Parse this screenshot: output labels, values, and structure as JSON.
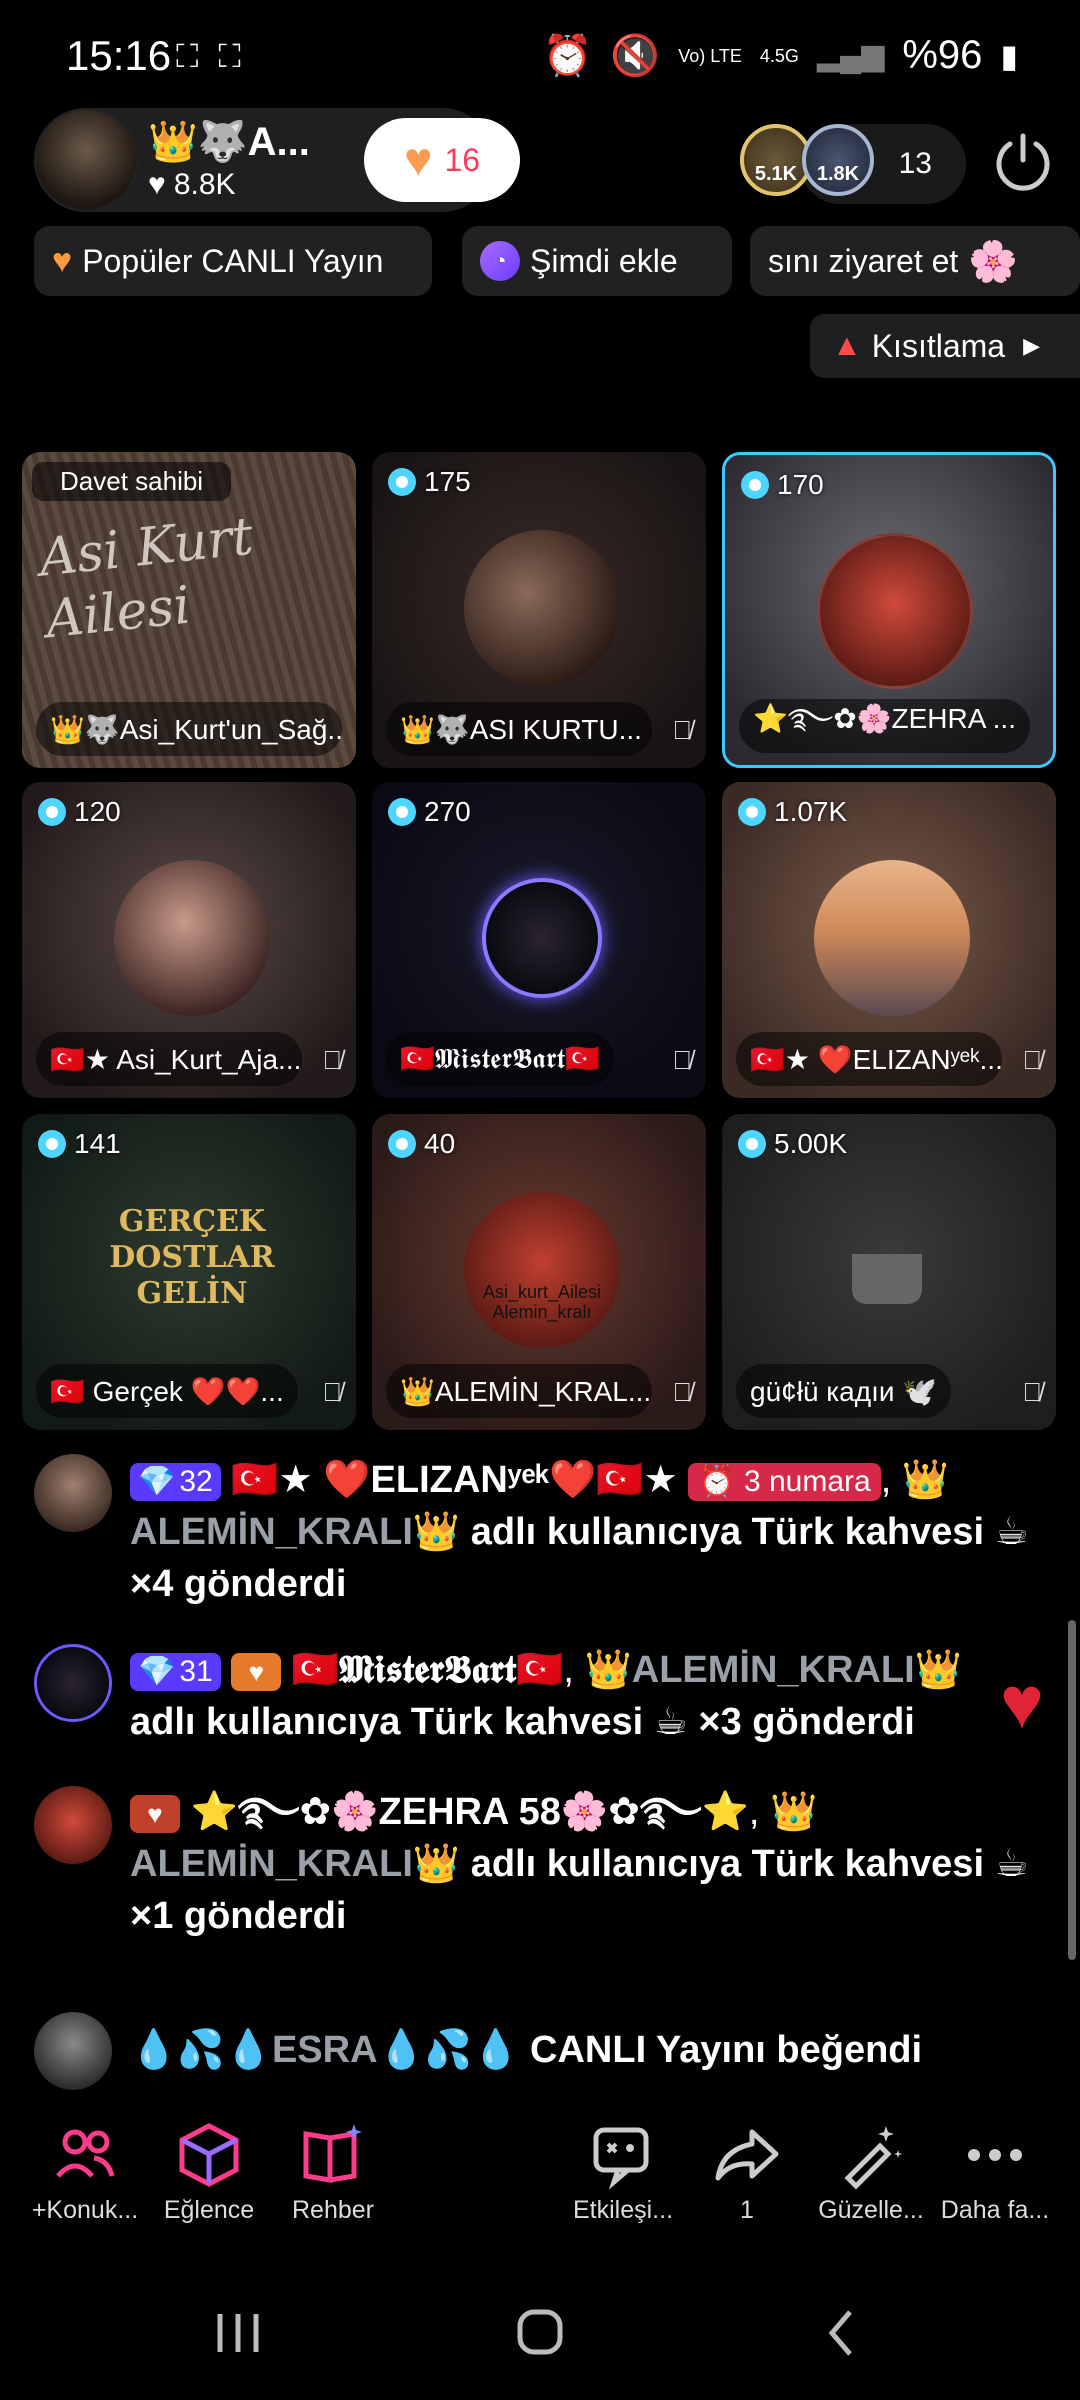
{
  "status_bar": {
    "time": "15:16",
    "network": "4.5G",
    "volte": "Vo) LTE",
    "battery": "%96"
  },
  "host": {
    "name": "👑🐺A...",
    "likes": "8.8K",
    "follow_count": "16"
  },
  "viewers": {
    "avatar1_count": "5.1K",
    "avatar2_count": "1.8K",
    "count": "13"
  },
  "chips": [
    {
      "label": "Popüler CANLI Yayın"
    },
    {
      "label": "Şimdi ekle"
    },
    {
      "label": "sını ziyaret et"
    }
  ],
  "restrict_label": "Kısıtlama",
  "grid": {
    "host_label": "Davet sahibi",
    "host_tile_text": "Asi Kurt Ailesi",
    "tiles": [
      {
        "name": "👑🐺Asi_Kurt'un_Sağ...",
        "count": ""
      },
      {
        "name": "👑🐺ASI KURTU...",
        "count": "175"
      },
      {
        "name": "⭐࿐✿🌸ZEHRA ...",
        "count": "170"
      },
      {
        "name": "🇹🇷★ Asi_Kurt_Aja...",
        "count": "120"
      },
      {
        "name": "🇹🇷𝕸𝖎𝖘𝖙𝖊𝖗𝕭𝖆𝖗𝖙🇹🇷",
        "count": "270"
      },
      {
        "name": "🇹🇷★ ❤️ELIZANʸᵉᵏ...",
        "count": "1.07K"
      },
      {
        "name": "🇹🇷 Gerçek ❤️❤️...",
        "count": "141"
      },
      {
        "name": "👑ALEMİN_KRAL...",
        "count": "40"
      },
      {
        "name": "gü¢łü кадıи 🕊️",
        "count": "5.00K"
      }
    ],
    "tile7_art": "GERÇEK DOSTLAR GELİN",
    "tile8_art": "Asi_kurt_Ailesi Alemin_kralı"
  },
  "chat": [
    {
      "level": "32",
      "user": "🇹🇷★ ❤️ELIZANʸᵉᵏ❤️🇹🇷★",
      "tag": "3 numara",
      "target": "ALEMİN_KRALI👑",
      "text": " adlı kullanıcıya Türk kahvesi ☕ ×4 gönderdi"
    },
    {
      "level": "31",
      "user": "🇹🇷𝕸𝖎𝖘𝖙𝖊𝖗𝕭𝖆𝖗𝖙🇹🇷",
      "target": "👑ALEMİN_KRALI👑",
      "text": "adlı kullanıcıya Türk kahvesi ☕ ×3 gönderdi"
    },
    {
      "user": "⭐࿐✿🌸ZEHRA 58🌸✿࿐⭐",
      "target": "ALEMİN_KRALI👑",
      "text": " adlı kullanıcıya Türk kahvesi ☕ ×1 gönderdi"
    },
    {
      "user": "💧💦💧ESRA💧💦💧",
      "text": " CANLI Yayını beğendi"
    }
  ],
  "toolbar": {
    "items": [
      {
        "label": "+Konuk...",
        "icon": "guests-icon"
      },
      {
        "label": "Eğlence",
        "icon": "cube-icon"
      },
      {
        "label": "Rehber",
        "icon": "book-icon"
      },
      {
        "label": "Etkileşi...",
        "icon": "interaction-icon"
      },
      {
        "label": "1",
        "icon": "share-icon"
      },
      {
        "label": "Güzelle...",
        "icon": "beauty-wand-icon"
      },
      {
        "label": "Daha fa...",
        "icon": "more-icon"
      }
    ]
  },
  "colors": {
    "accent_pink": "#ff3b8c",
    "follow_red": "#ff3b5c",
    "selected_border": "#3fc8ff",
    "level_purple": "#5a3aff"
  }
}
